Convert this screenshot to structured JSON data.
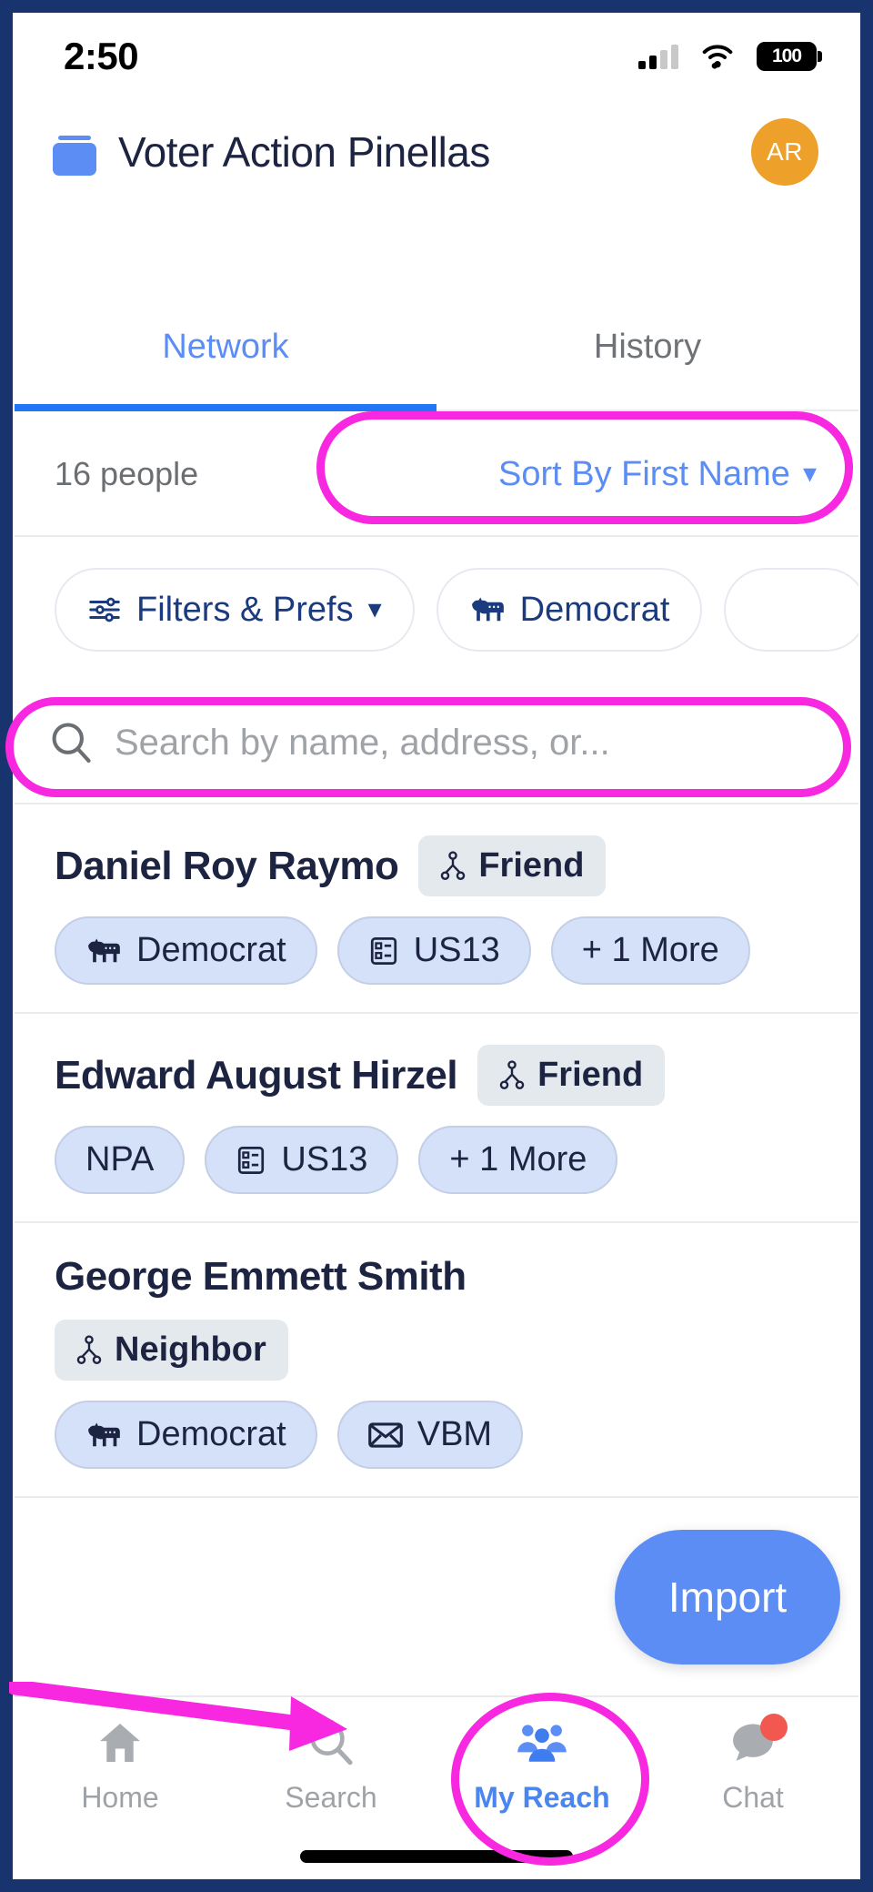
{
  "status_bar": {
    "time": "2:50",
    "signal_icon": "cellular-signal-icon",
    "wifi_icon": "wifi-icon",
    "battery_level": "100"
  },
  "header": {
    "logo_icon": "ballot-box-icon",
    "title": "Voter Action Pinellas",
    "avatar_initials": "AR"
  },
  "tabs": [
    {
      "label": "Network",
      "active": true
    },
    {
      "label": "History",
      "active": false
    }
  ],
  "sort_row": {
    "people_count": "16 people",
    "sort_label": "Sort By First Name",
    "chevron": "⌄"
  },
  "filters": [
    {
      "label": "Filters & Prefs",
      "icon": "sliders-icon",
      "chevron": "⌄"
    },
    {
      "label": "Democrat",
      "icon": "donkey-icon"
    },
    {
      "label": "",
      "icon": ""
    }
  ],
  "search": {
    "placeholder": "Search by name, address, or...",
    "icon": "search-icon"
  },
  "people": [
    {
      "name": "Daniel Roy Raymo",
      "relationship": "Friend",
      "relationship_icon": "network-node-icon",
      "tags": [
        {
          "label": "Democrat",
          "icon": "donkey-icon"
        },
        {
          "label": "US13",
          "icon": "ballot-card-icon"
        },
        {
          "label": "+ 1 More",
          "icon": ""
        }
      ]
    },
    {
      "name": "Edward August Hirzel",
      "relationship": "Friend",
      "relationship_icon": "network-node-icon",
      "tags": [
        {
          "label": "NPA",
          "icon": ""
        },
        {
          "label": "US13",
          "icon": "ballot-card-icon"
        },
        {
          "label": "+ 1 More",
          "icon": ""
        }
      ]
    },
    {
      "name": "George Emmett Smith",
      "relationship": "Neighbor",
      "relationship_icon": "network-node-icon",
      "tags": [
        {
          "label": "Democrat",
          "icon": "donkey-icon"
        },
        {
          "label": "VBM",
          "icon": "envelope-icon"
        }
      ]
    }
  ],
  "fab": {
    "label": "Import"
  },
  "bottom_nav": [
    {
      "label": "Home",
      "icon": "home-icon",
      "active": false,
      "badge": false
    },
    {
      "label": "Search",
      "icon": "search-icon",
      "active": false,
      "badge": false
    },
    {
      "label": "My Reach",
      "icon": "people-group-icon",
      "active": true,
      "badge": false
    },
    {
      "label": "Chat",
      "icon": "chat-bubble-icon",
      "active": false,
      "badge": true
    }
  ],
  "annotations": {
    "color": "#f728e0",
    "highlight_sort": "Sort By First Name",
    "highlight_search": "Search by name, address, or...",
    "highlight_nav": "My Reach"
  },
  "colors": {
    "frame": "#18346e",
    "accent_blue": "#5b8df5",
    "tab_underline": "#2176f5",
    "navy_text": "#1d2442",
    "tag_bg": "#d5e0f9",
    "badge_bg": "#e4e9ee",
    "avatar_bg": "#eda02a",
    "annotation": "#f728e0",
    "chat_badge": "#f2584f"
  }
}
